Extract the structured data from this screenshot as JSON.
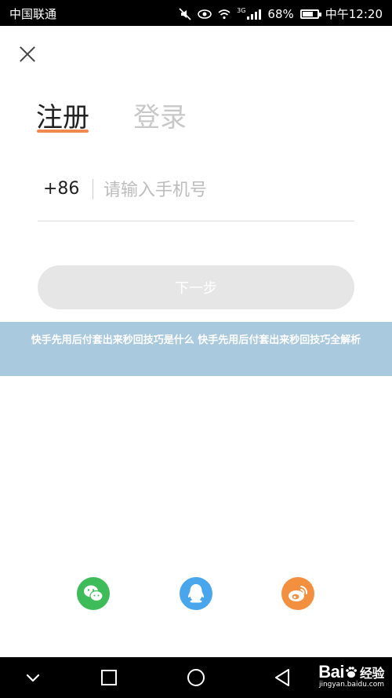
{
  "status_bar": {
    "carrier": "中国联通",
    "network": "3G",
    "battery": "68%",
    "battery_level": 0.68,
    "time": "中午12:20"
  },
  "auth": {
    "tabs": [
      {
        "label": "注册",
        "active": true
      },
      {
        "label": "登录",
        "active": false
      }
    ],
    "country_code": "+86",
    "phone_placeholder": "请输入手机号",
    "next_label": "下一步"
  },
  "banner": {
    "text": "快手先用后付套出来秒回技巧是什么 快手先用后付套出来秒回技巧全解析"
  },
  "social_login": [
    {
      "name": "wechat",
      "icon": "wechat-icon",
      "color": "#3fbc5a"
    },
    {
      "name": "qq",
      "icon": "qq-icon",
      "color": "#4aa6ec"
    },
    {
      "name": "weibo",
      "icon": "weibo-icon",
      "color": "#f29040"
    }
  ],
  "watermark": {
    "logo_latin": "Bai",
    "logo_cn": "经验",
    "url": "jingyan.baidu.com"
  },
  "colors": {
    "accent": "#f08a4b",
    "button_disabled": "#e6e6e6",
    "banner": "#a3c5dc"
  }
}
